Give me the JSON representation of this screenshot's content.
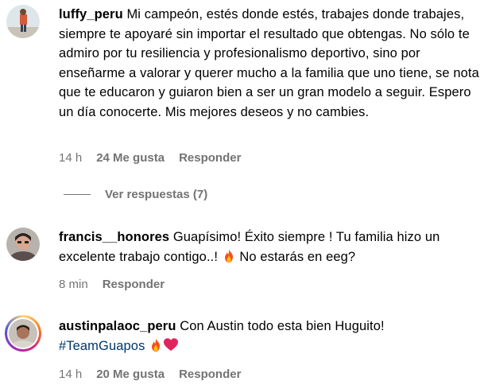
{
  "comments": [
    {
      "username": "luffy_peru",
      "text": "Mi campeón, estés donde estés, trabajes donde trabajes, siempre te apoyaré sin importar el resultado que obtengas. No sólo te admiro por tu resiliencia y profesionalismo deportivo, sino por enseñarme a valorar y querer mucho a la familia que uno tiene, se nota que te educaron y guiaron bien a ser un gran modelo a seguir. Espero un día conocerte. Mis mejores deseos y no cambies.",
      "time": "14 h",
      "likes": "24 Me gusta",
      "reply": "Responder",
      "view_replies": "Ver respuestas (7)"
    },
    {
      "username": "francis__honores",
      "text_before": "Guapísimo! Éxito siempre ! Tu familia hizo un excelente trabajo contigo..! ",
      "text_after": " No estarás en eeg?",
      "time": "8 min",
      "reply": "Responder"
    },
    {
      "username": "austinpalaoc_peru",
      "text": "Con Austin todo esta bien Huguito!",
      "hashtag": "#TeamGuapos",
      "time": "14 h",
      "likes": "20 Me gusta",
      "reply": "Responder"
    }
  ],
  "icons": {
    "fire": "fire-emoji",
    "heart": "red-heart-emoji"
  },
  "colors": {
    "meta_text": "#737373",
    "hashtag": "#00376b",
    "heart": "#e0245e"
  }
}
